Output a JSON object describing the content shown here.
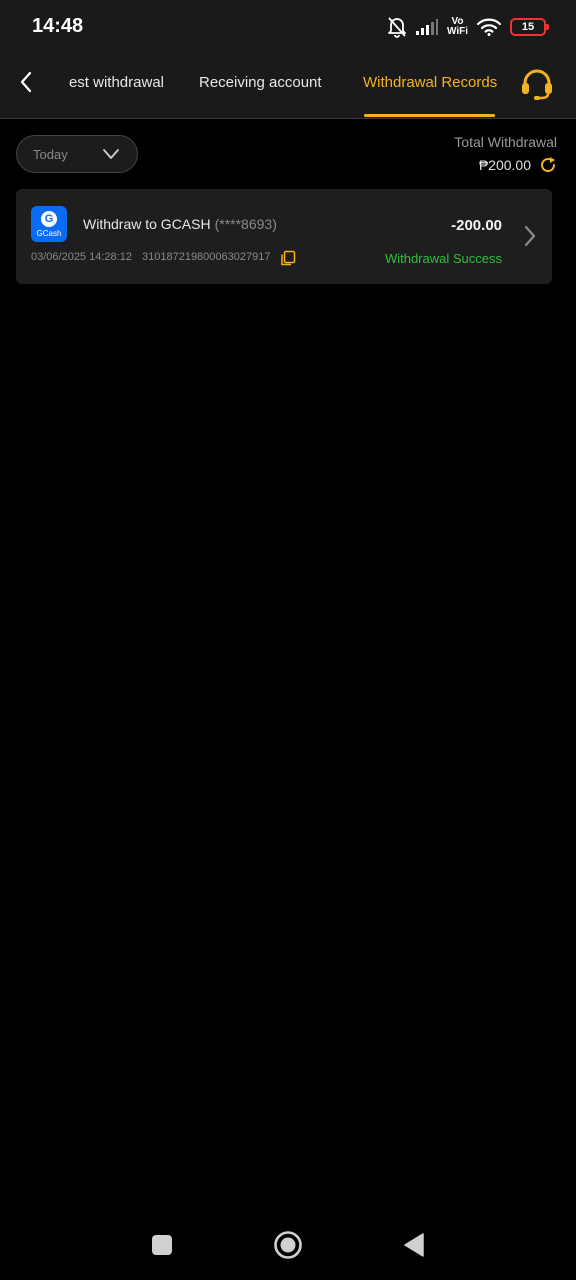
{
  "status_bar": {
    "time": "14:48",
    "network_top": "Vo",
    "network_bottom": "WiFi",
    "battery": "15",
    "icons": [
      "bell-off-icon",
      "signal-icon",
      "wifi-icon",
      "battery-icon"
    ]
  },
  "header": {
    "back_icon": "chevron-left-icon",
    "tabs": [
      {
        "label": "Request withdrawal",
        "active": false
      },
      {
        "label": "Receiving account",
        "active": false
      },
      {
        "label": "Withdrawal Records",
        "active": true
      }
    ],
    "support_icon": "headset-icon",
    "accent_color": "#f5b21f"
  },
  "filter": {
    "date_label": "Today",
    "dropdown_icon": "chevron-down-icon"
  },
  "summary": {
    "total_label": "Total Withdrawal",
    "total_amount": "₱200.00",
    "refresh_icon": "refresh-icon"
  },
  "records": [
    {
      "logo_text": "GCash",
      "logo_letter": "G",
      "title": "Withdraw to GCASH",
      "account": "(****8693)",
      "amount": "-200.00",
      "datetime": "03/06/2025 14:28:12",
      "order_id": "310187219800063027917",
      "status": "Withdrawal Success",
      "status_color": "#2dbf3a"
    }
  ],
  "nav_bar": {
    "icons": [
      "recents-square-icon",
      "home-circle-icon",
      "back-triangle-icon"
    ]
  }
}
